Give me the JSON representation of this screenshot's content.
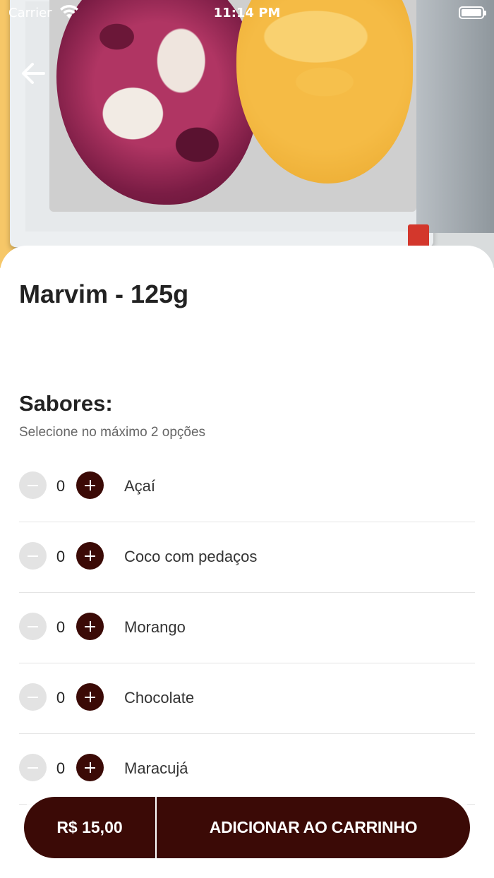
{
  "status_bar": {
    "carrier": "Carrier",
    "time": "11:14 PM"
  },
  "hero": {
    "image": "ice-cream-photo"
  },
  "product": {
    "title": "Marvim - 125g"
  },
  "section": {
    "title": "Sabores:",
    "subtitle": "Selecione no máximo 2 opções"
  },
  "options": [
    {
      "name": "Açaí",
      "quantity": "0"
    },
    {
      "name": "Coco com pedaços",
      "quantity": "0"
    },
    {
      "name": "Morango",
      "quantity": "0"
    },
    {
      "name": "Chocolate",
      "quantity": "0"
    },
    {
      "name": "Maracujá",
      "quantity": "0"
    }
  ],
  "cart": {
    "price": "R$ 15,00",
    "add_label": "ADICIONAR AO CARRINHO"
  },
  "colors": {
    "accent": "#3b0a06",
    "minus_disabled": "#e3e3e3"
  }
}
